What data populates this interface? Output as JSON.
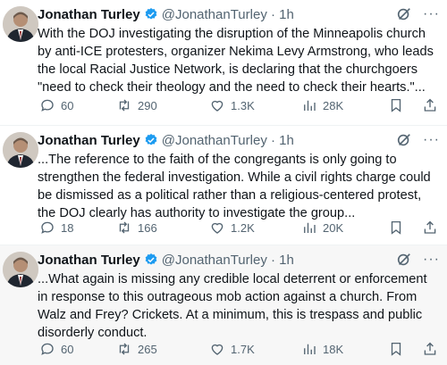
{
  "colors": {
    "verified": "#1d9bf0",
    "secondary": "#536471",
    "text": "#0f1419"
  },
  "tweets": [
    {
      "name": "Jonathan Turley",
      "handle": "@JonathanTurley · 1h",
      "text": "With the DOJ investigating the disruption of the Minneapolis church by anti-ICE protesters, organizer Nekima Levy Armstrong, who leads the local Racial Justice Network, is declaring that the churchgoers \"need to check their theology and the need to check their hearts.\"...",
      "replies": "60",
      "reposts": "290",
      "likes": "1.3K",
      "views": "28K"
    },
    {
      "name": "Jonathan Turley",
      "handle": "@JonathanTurley · 1h",
      "text": "...The reference to the faith of the congregants is only going to strengthen the federal investigation. While a civil rights charge could be dismissed as a political rather than a religious-centered protest, the DOJ clearly has authority to investigate the group...",
      "replies": "18",
      "reposts": "166",
      "likes": "1.2K",
      "views": "20K"
    },
    {
      "name": "Jonathan Turley",
      "handle": "@JonathanTurley · 1h",
      "text": "...What again is missing any credible local deterrent or enforcement in response to this outrageous mob action against a church. From Walz and Frey? Crickets. At a minimum, this is trespass and public disorderly conduct.",
      "replies": "60",
      "reposts": "265",
      "likes": "1.7K",
      "views": "18K"
    }
  ]
}
